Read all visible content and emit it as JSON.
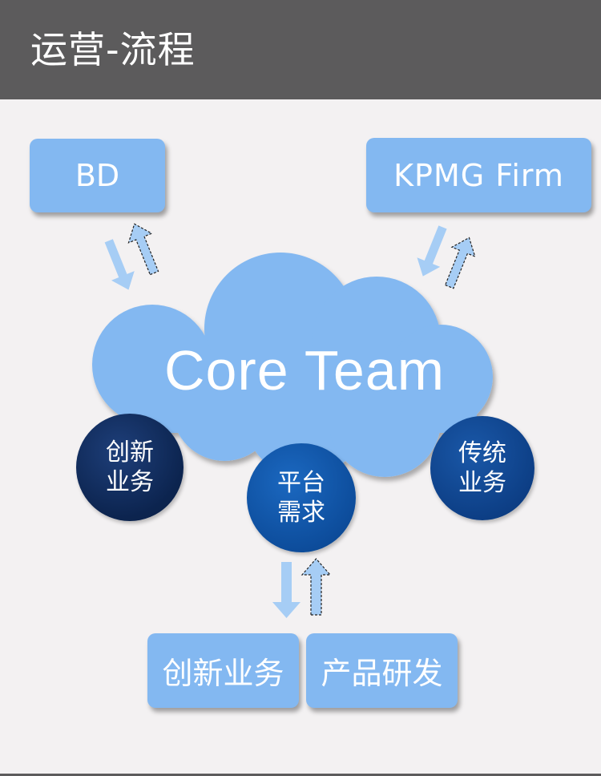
{
  "header": {
    "title": "运营-流程"
  },
  "boxes": {
    "bd": "BD",
    "kpmg": "KPMG Firm",
    "innovation_business": "创新业务",
    "product_rd": "产品研发"
  },
  "cloud": {
    "label": "Core Team"
  },
  "circles": {
    "innovation": {
      "line1": "创新",
      "line2": "业务"
    },
    "platform": {
      "line1": "平台",
      "line2": "需求"
    },
    "traditional": {
      "line1": "传统",
      "line2": "业务"
    }
  },
  "colors": {
    "header_bg": "#5c5b5c",
    "page_bg": "#f3f1f2",
    "box_blue": "#83b8f1",
    "cloud_blue": "#83b8f1",
    "arrow_blue": "#a6cdf5",
    "circle_dark_navy": "#0c244f",
    "circle_mid_blue": "#0d4d9c",
    "circle_royal_blue": "#0d3f86"
  }
}
